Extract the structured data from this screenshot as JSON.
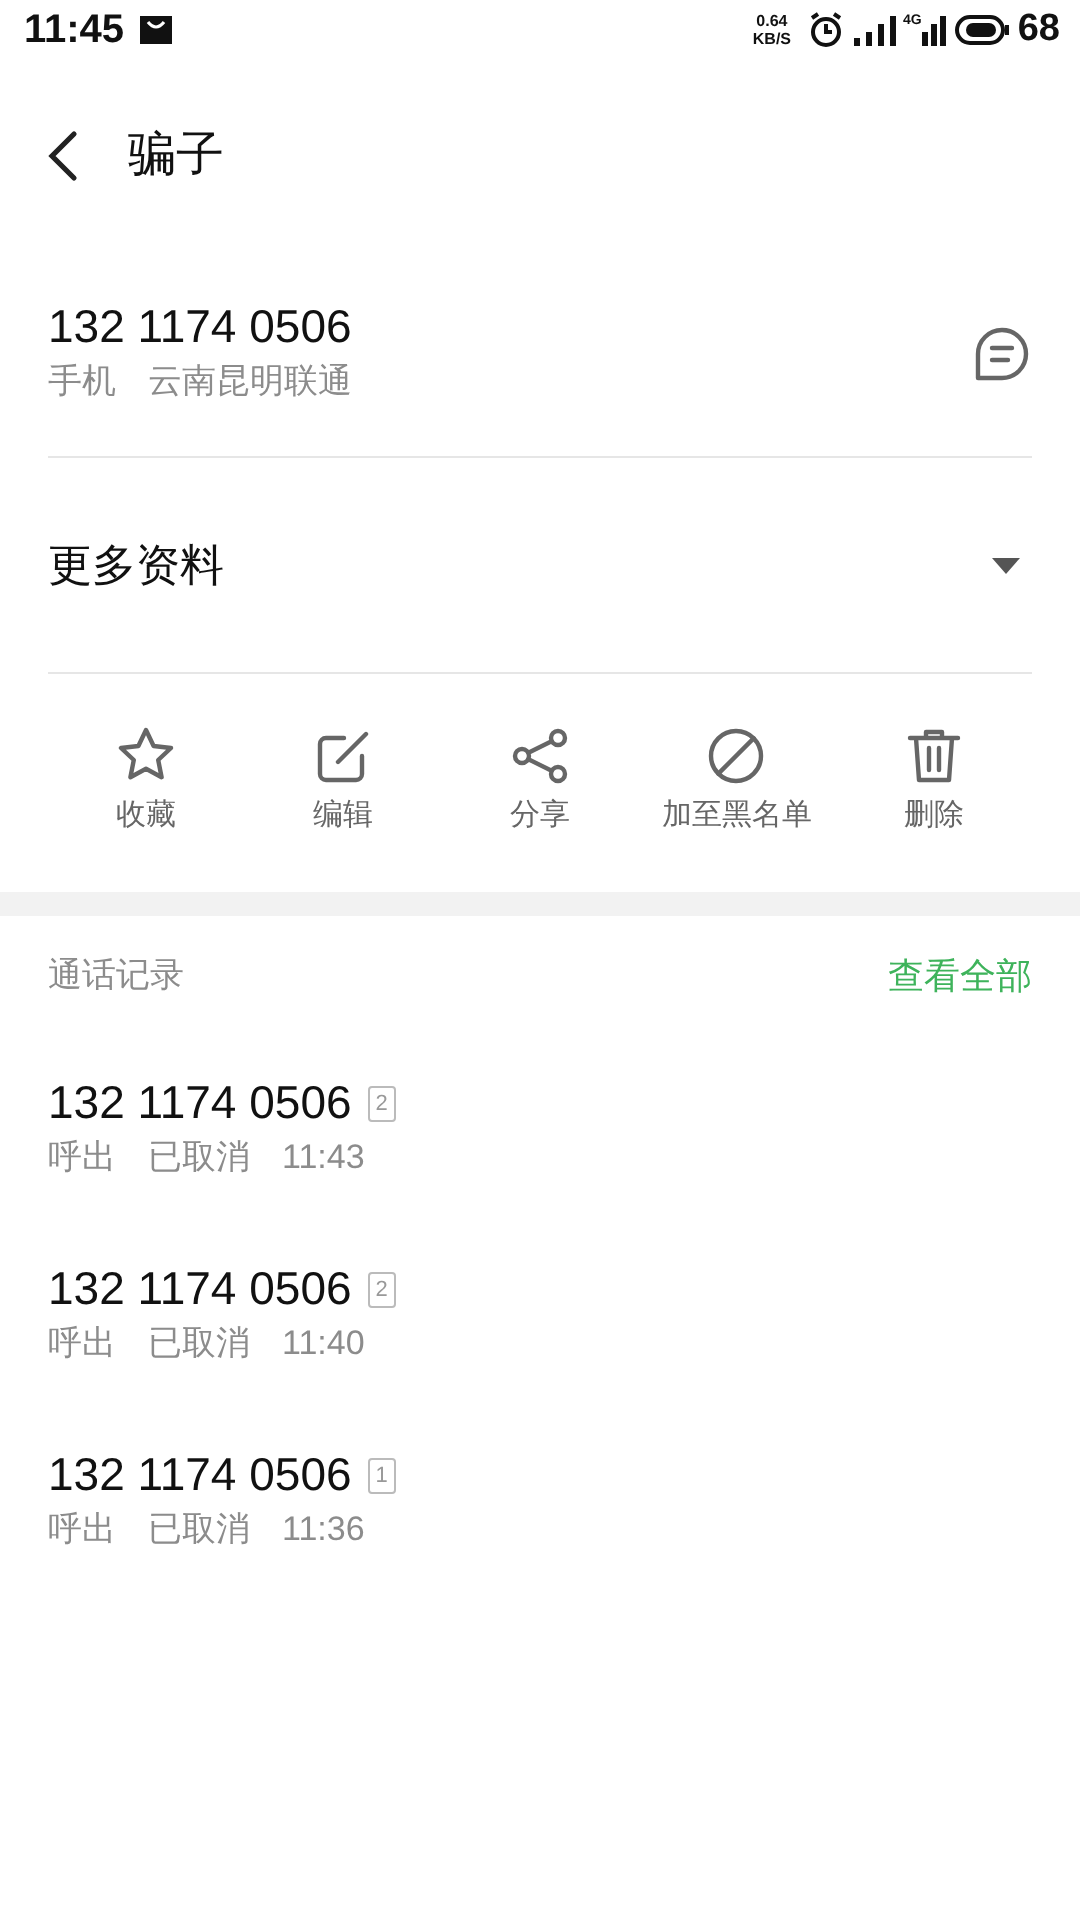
{
  "status_bar": {
    "time": "11:45",
    "speed_value": "0.64",
    "speed_unit": "KB/S",
    "network": "4G",
    "battery": "68"
  },
  "header": {
    "title": "骗子"
  },
  "phone": {
    "number": "132 1174 0506",
    "type": "手机",
    "location": "云南昆明联通"
  },
  "more_info": {
    "label": "更多资料",
    "expanded": false
  },
  "actions": [
    {
      "kind": "star",
      "label": "收藏"
    },
    {
      "kind": "edit",
      "label": "编辑"
    },
    {
      "kind": "share",
      "label": "分享"
    },
    {
      "kind": "block",
      "label": "加至黑名单"
    },
    {
      "kind": "delete",
      "label": "删除"
    }
  ],
  "call_log": {
    "title": "通话记录",
    "view_all": "查看全部",
    "calls": [
      {
        "number": "132 1174 0506",
        "sim": "2",
        "direction": "呼出",
        "status": "已取消",
        "time": "11:43"
      },
      {
        "number": "132 1174 0506",
        "sim": "2",
        "direction": "呼出",
        "status": "已取消",
        "time": "11:40"
      },
      {
        "number": "132 1174 0506",
        "sim": "1",
        "direction": "呼出",
        "status": "已取消",
        "time": "11:36"
      }
    ]
  }
}
